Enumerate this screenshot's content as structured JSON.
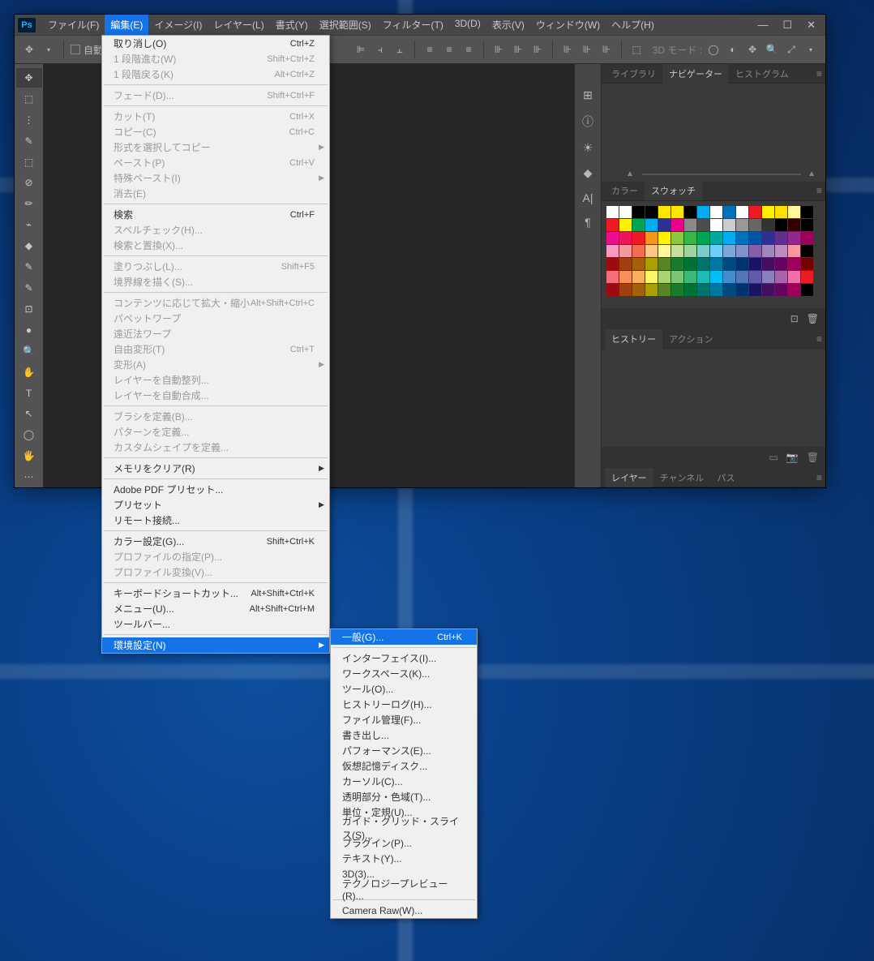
{
  "menubar": [
    "ファイル(F)",
    "編集(E)",
    "イメージ(I)",
    "レイヤー(L)",
    "書式(Y)",
    "選択範囲(S)",
    "フィルター(T)",
    "3D(D)",
    "表示(V)",
    "ウィンドウ(W)",
    "ヘルプ(H)"
  ],
  "optbar": {
    "auto_label": "自動",
    "mode_label": "3D モード :"
  },
  "right": {
    "tabs1": [
      "ライブラリ",
      "ナビゲーター",
      "ヒストグラム"
    ],
    "tabs2": [
      "カラー",
      "スウォッチ"
    ],
    "tabs3": [
      "ヒストリー",
      "アクション"
    ],
    "tabs4": [
      "レイヤー",
      "チャンネル",
      "パス"
    ]
  },
  "edit_menu": [
    [
      {
        "l": "取り消し(O)",
        "s": "Ctrl+Z"
      },
      {
        "l": "1 段階進む(W)",
        "s": "Shift+Ctrl+Z",
        "d": 1
      },
      {
        "l": "1 段階戻る(K)",
        "s": "Alt+Ctrl+Z",
        "d": 1
      }
    ],
    [
      {
        "l": "フェード(D)...",
        "s": "Shift+Ctrl+F",
        "d": 1
      }
    ],
    [
      {
        "l": "カット(T)",
        "s": "Ctrl+X",
        "d": 1
      },
      {
        "l": "コピー(C)",
        "s": "Ctrl+C",
        "d": 1
      },
      {
        "l": "形式を選択してコピー",
        "a": 1,
        "d": 1
      },
      {
        "l": "ペースト(P)",
        "s": "Ctrl+V",
        "d": 1
      },
      {
        "l": "特殊ペースト(I)",
        "a": 1,
        "d": 1
      },
      {
        "l": "消去(E)",
        "d": 1
      }
    ],
    [
      {
        "l": "検索",
        "s": "Ctrl+F"
      },
      {
        "l": "スペルチェック(H)...",
        "d": 1
      },
      {
        "l": "検索と置換(X)...",
        "d": 1
      }
    ],
    [
      {
        "l": "塗りつぶし(L)...",
        "s": "Shift+F5",
        "d": 1
      },
      {
        "l": "境界線を描く(S)...",
        "d": 1
      }
    ],
    [
      {
        "l": "コンテンツに応じて拡大・縮小",
        "s": "Alt+Shift+Ctrl+C",
        "d": 1
      },
      {
        "l": "パペットワープ",
        "d": 1
      },
      {
        "l": "遠近法ワープ",
        "d": 1
      },
      {
        "l": "自由変形(T)",
        "s": "Ctrl+T",
        "d": 1
      },
      {
        "l": "変形(A)",
        "a": 1,
        "d": 1
      },
      {
        "l": "レイヤーを自動整列...",
        "d": 1
      },
      {
        "l": "レイヤーを自動合成...",
        "d": 1
      }
    ],
    [
      {
        "l": "ブラシを定義(B)...",
        "d": 1
      },
      {
        "l": "パターンを定義...",
        "d": 1
      },
      {
        "l": "カスタムシェイプを定義...",
        "d": 1
      }
    ],
    [
      {
        "l": "メモリをクリア(R)",
        "a": 1
      }
    ],
    [
      {
        "l": "Adobe PDF プリセット..."
      },
      {
        "l": "プリセット",
        "a": 1
      },
      {
        "l": "リモート接続..."
      }
    ],
    [
      {
        "l": "カラー設定(G)...",
        "s": "Shift+Ctrl+K"
      },
      {
        "l": "プロファイルの指定(P)...",
        "d": 1
      },
      {
        "l": "プロファイル変換(V)...",
        "d": 1
      }
    ],
    [
      {
        "l": "キーボードショートカット...",
        "s": "Alt+Shift+Ctrl+K"
      },
      {
        "l": "メニュー(U)...",
        "s": "Alt+Shift+Ctrl+M"
      },
      {
        "l": "ツールバー..."
      }
    ],
    [
      {
        "l": "環境設定(N)",
        "a": 1,
        "hl": 1
      }
    ]
  ],
  "pref_menu": [
    [
      {
        "l": "一般(G)...",
        "s": "Ctrl+K",
        "hl": 1
      }
    ],
    [
      {
        "l": "インターフェイス(I)..."
      },
      {
        "l": "ワークスペース(K)..."
      },
      {
        "l": "ツール(O)..."
      },
      {
        "l": "ヒストリーログ(H)..."
      },
      {
        "l": "ファイル管理(F)..."
      },
      {
        "l": "書き出し..."
      },
      {
        "l": "パフォーマンス(E)..."
      },
      {
        "l": "仮想記憶ディスク..."
      },
      {
        "l": "カーソル(C)..."
      },
      {
        "l": "透明部分・色域(T)..."
      },
      {
        "l": "単位・定規(U)..."
      },
      {
        "l": "ガイド・グリッド・スライス(S)..."
      },
      {
        "l": "プラグイン(P)..."
      },
      {
        "l": "テキスト(Y)..."
      },
      {
        "l": "3D(3)..."
      },
      {
        "l": "テクノロジープレビュー(R)..."
      }
    ],
    [
      {
        "l": "Camera Raw(W)..."
      }
    ]
  ],
  "swatches": [
    "#ffffff",
    "#ffffff",
    "#000000",
    "#000000",
    "#ffe600",
    "#ffe600",
    "#000000",
    "#00aeef",
    "#ffffff",
    "#0072bc",
    "#ffffff",
    "#ed1c24",
    "#fff200",
    "#ffde00",
    "#fff799",
    "#000000",
    "#ed1c24",
    "#fff200",
    "#00a651",
    "#00aeef",
    "#2e3192",
    "#ec008c",
    "#898989",
    "#4d4d4d",
    "#ffffff",
    "#cccccc",
    "#999999",
    "#666666",
    "#333333",
    "#000000",
    "#330000",
    "#000000",
    "#ec0e8c",
    "#ed145b",
    "#ed1c24",
    "#f7941d",
    "#fff200",
    "#8dc63f",
    "#39b54a",
    "#00a651",
    "#00a99d",
    "#00aeef",
    "#0072bc",
    "#0054a6",
    "#2e3192",
    "#662d91",
    "#92278f",
    "#9e005d",
    "#f49ac1",
    "#f5989d",
    "#f26c4f",
    "#fdc689",
    "#fff799",
    "#c4df9b",
    "#a3d39c",
    "#7accc8",
    "#6dcff6",
    "#7da7d9",
    "#8393ca",
    "#8560a8",
    "#a186be",
    "#bd8cbf",
    "#f6989d",
    "#000000",
    "#9e0b0f",
    "#a0410d",
    "#a3620a",
    "#aba000",
    "#598527",
    "#197b30",
    "#007236",
    "#00746b",
    "#0076a3",
    "#004a80",
    "#003471",
    "#1b1464",
    "#440e62",
    "#630460",
    "#9e005d",
    "#790000",
    "#f26d7d",
    "#f68e56",
    "#fbaf5d",
    "#fff568",
    "#acd373",
    "#7cc576",
    "#3cb878",
    "#1cbbb4",
    "#00bff3",
    "#448ccb",
    "#5674b9",
    "#605ca8",
    "#8781bd",
    "#a864a8",
    "#f06eaa",
    "#ed1c24",
    "#9e0b0f",
    "#a0410d",
    "#a3620a",
    "#aba000",
    "#598527",
    "#197b30",
    "#007236",
    "#00746b",
    "#0076a3",
    "#004a80",
    "#003471",
    "#1b1464",
    "#440e62",
    "#630460",
    "#9e005d",
    "#000000"
  ]
}
